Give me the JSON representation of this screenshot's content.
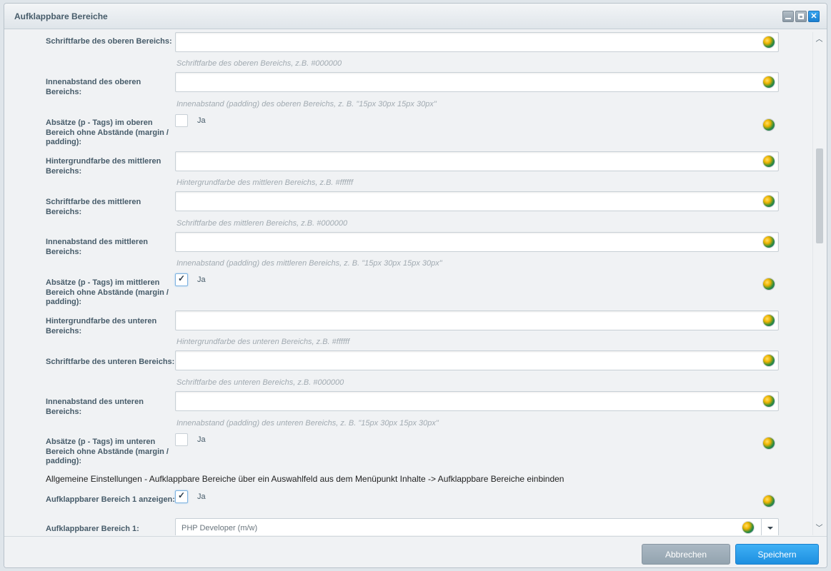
{
  "window": {
    "title": "Aufklappbare Bereiche"
  },
  "fields": [
    {
      "label": "Schriftfarbe des oberen Bereichs:",
      "value": "",
      "hint": "Schriftfarbe des oberen Bereichs, z.B. #000000"
    },
    {
      "label": "Innenabstand des oberen Bereichs:",
      "value": "",
      "hint": "Innenabstand (padding) des oberen Bereichs, z. B. \"15px 30px 15px 30px\""
    },
    {
      "label": "Absätze (p - Tags) im oberen Bereich ohne Abstände (margin / padding):",
      "checkbox_label": "Ja",
      "checked": false
    },
    {
      "label": "Hintergrundfarbe des mittleren Bereichs:",
      "value": "",
      "hint": "Hintergrundfarbe des mittleren Bereichs, z.B. #ffffff"
    },
    {
      "label": "Schriftfarbe des mittleren Bereichs:",
      "value": "",
      "hint": "Schriftfarbe des mittleren Bereichs, z.B. #000000"
    },
    {
      "label": "Innenabstand des mittleren Bereichs:",
      "value": "",
      "hint": "Innenabstand (padding) des mittleren Bereichs, z. B. \"15px 30px 15px 30px\""
    },
    {
      "label": "Absätze (p - Tags) im mittleren Bereich ohne Abstände (margin / padding):",
      "checkbox_label": "Ja",
      "checked": true
    },
    {
      "label": "Hintergrundfarbe des unteren Bereichs:",
      "value": "",
      "hint": "Hintergrundfarbe des unteren Bereichs, z.B. #ffffff"
    },
    {
      "label": "Schriftfarbe des unteren Bereichs:",
      "value": "",
      "hint": "Schriftfarbe des unteren Bereichs, z.B. #000000"
    },
    {
      "label": "Innenabstand des unteren Bereichs:",
      "value": "",
      "hint": "Innenabstand (padding) des unteren Bereichs, z. B. \"15px 30px 15px 30px\""
    },
    {
      "label": "Absätze (p - Tags) im unteren Bereich ohne Abstände (margin / padding):",
      "checkbox_label": "Ja",
      "checked": false
    }
  ],
  "section": {
    "title": "Allgemeine Einstellungen - Aufklappbare Bereiche über ein Auswahlfeld aus dem Menüpunkt Inhalte -> Aufklappbare Bereiche einbinden"
  },
  "general": {
    "show_label": "Aufklappbarer Bereich 1 anzeigen:",
    "show_checkbox_label": "Ja",
    "show_checked": true,
    "select_label": "Aufklappbarer Bereich 1:",
    "select_value": "PHP Developer (m/w)"
  },
  "footer": {
    "cancel_label": "Abbrechen",
    "save_label": "Speichern"
  },
  "icons": {
    "translation": "globe-icon",
    "minimize": "minimize-icon",
    "maximize": "maximize-icon",
    "close": "close-icon"
  },
  "colors": {
    "accent": "#1d8fe0",
    "cancel": "#93a3af"
  }
}
